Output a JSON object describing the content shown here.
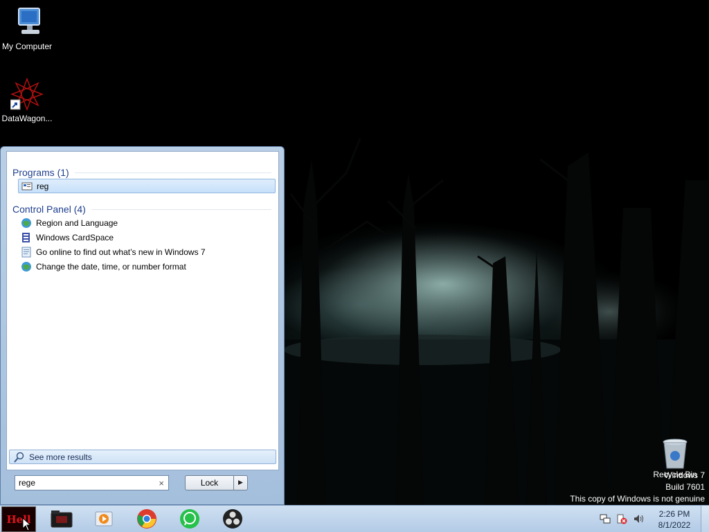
{
  "desktop": {
    "icons": [
      {
        "label": "My Computer",
        "icon": "computer-icon"
      },
      {
        "label": "DataWagon...",
        "icon": "datawagon-shortcut-icon"
      },
      {
        "label": "Recycle Bin",
        "icon": "recycle-bin-icon"
      }
    ],
    "watermark": {
      "line1": "Windows 7",
      "line2": "Build 7601",
      "line3": "This copy of Windows is not genuine"
    }
  },
  "start_menu": {
    "groups": [
      {
        "header": "Programs (1)",
        "items": [
          {
            "label": "reg",
            "icon": "regedit-icon",
            "selected": true
          }
        ]
      },
      {
        "header": "Control Panel (4)",
        "items": [
          {
            "label": "Region and Language",
            "icon": "globe-icon"
          },
          {
            "label": "Windows CardSpace",
            "icon": "cardspace-icon"
          },
          {
            "label": "Go online to find out what’s new in Windows 7",
            "icon": "document-icon"
          },
          {
            "label": "Change the date, time, or number format",
            "icon": "globe-icon"
          }
        ]
      }
    ],
    "see_more": "See more results",
    "search": {
      "value": "rege",
      "clear": "×"
    },
    "lock_button": "Lock",
    "lock_arrow": "▶"
  },
  "taskbar": {
    "start_label": "Hell",
    "pinned": [
      {
        "name": "media-folder-icon"
      },
      {
        "name": "media-player-icon"
      },
      {
        "name": "chrome-icon"
      },
      {
        "name": "whatsapp-icon"
      },
      {
        "name": "obs-icon"
      }
    ],
    "tray": [
      "network-icon",
      "action-center-icon",
      "volume-icon"
    ],
    "clock": {
      "time": "2:26 PM",
      "date": "8/1/2022"
    }
  },
  "colors": {
    "accent": "#1e3e8e",
    "taskbar": "#bfd3ea",
    "selection": "#c7e0fa"
  }
}
